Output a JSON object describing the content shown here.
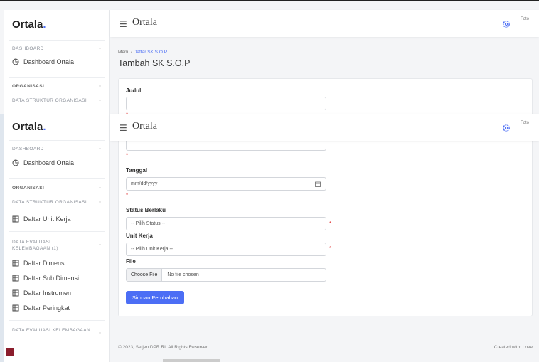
{
  "brand": {
    "name": "Ortala",
    "dot": "."
  },
  "header": {
    "title": "Ortala",
    "avatar_alt": "Foto"
  },
  "sidebar": {
    "sections": {
      "dashboard": "DASHBOARD",
      "organisasi": "ORGANISASI",
      "struktur": "DATA STRUKTUR ORGANISASI",
      "evaluasi1": "DATA EVALUASI KELEMBAGAAN (1)",
      "evaluasi2": "DATA EVALUASI KELEMBAGAAN"
    },
    "items": {
      "dashboard_ortala": "Dashboard Ortala",
      "unit_kerja": "Daftar Unit Kerja",
      "dimensi": "Daftar Dimensi",
      "sub_dimensi": "Daftar Sub Dimensi",
      "instrumen": "Daftar Instrumen",
      "peringkat": "Daftar Peringkat"
    }
  },
  "breadcrumb": {
    "root": "Menu",
    "sep": "/",
    "current": "Daftar SK S.O.P"
  },
  "page_title": "Tambah SK S.O.P",
  "form": {
    "judul_label": "Judul",
    "judul_value": "",
    "required_mark": "*",
    "tanggal_label": "Tanggal",
    "tanggal_placeholder": "mm/dd/yyyy",
    "status_label": "Status Berlaku",
    "status_value": "-- Pilih Status --",
    "unit_label": "Unit Kerja",
    "unit_value": "-- Pilih Unit Kerja --",
    "file_label": "File",
    "file_button": "Choose File",
    "file_value": "No file chosen",
    "submit": "Simpan Perubahan"
  },
  "footer": {
    "left": "© 2023, Setjen DPR RI. All Rights Reserved.",
    "right": "Created with: Love"
  }
}
